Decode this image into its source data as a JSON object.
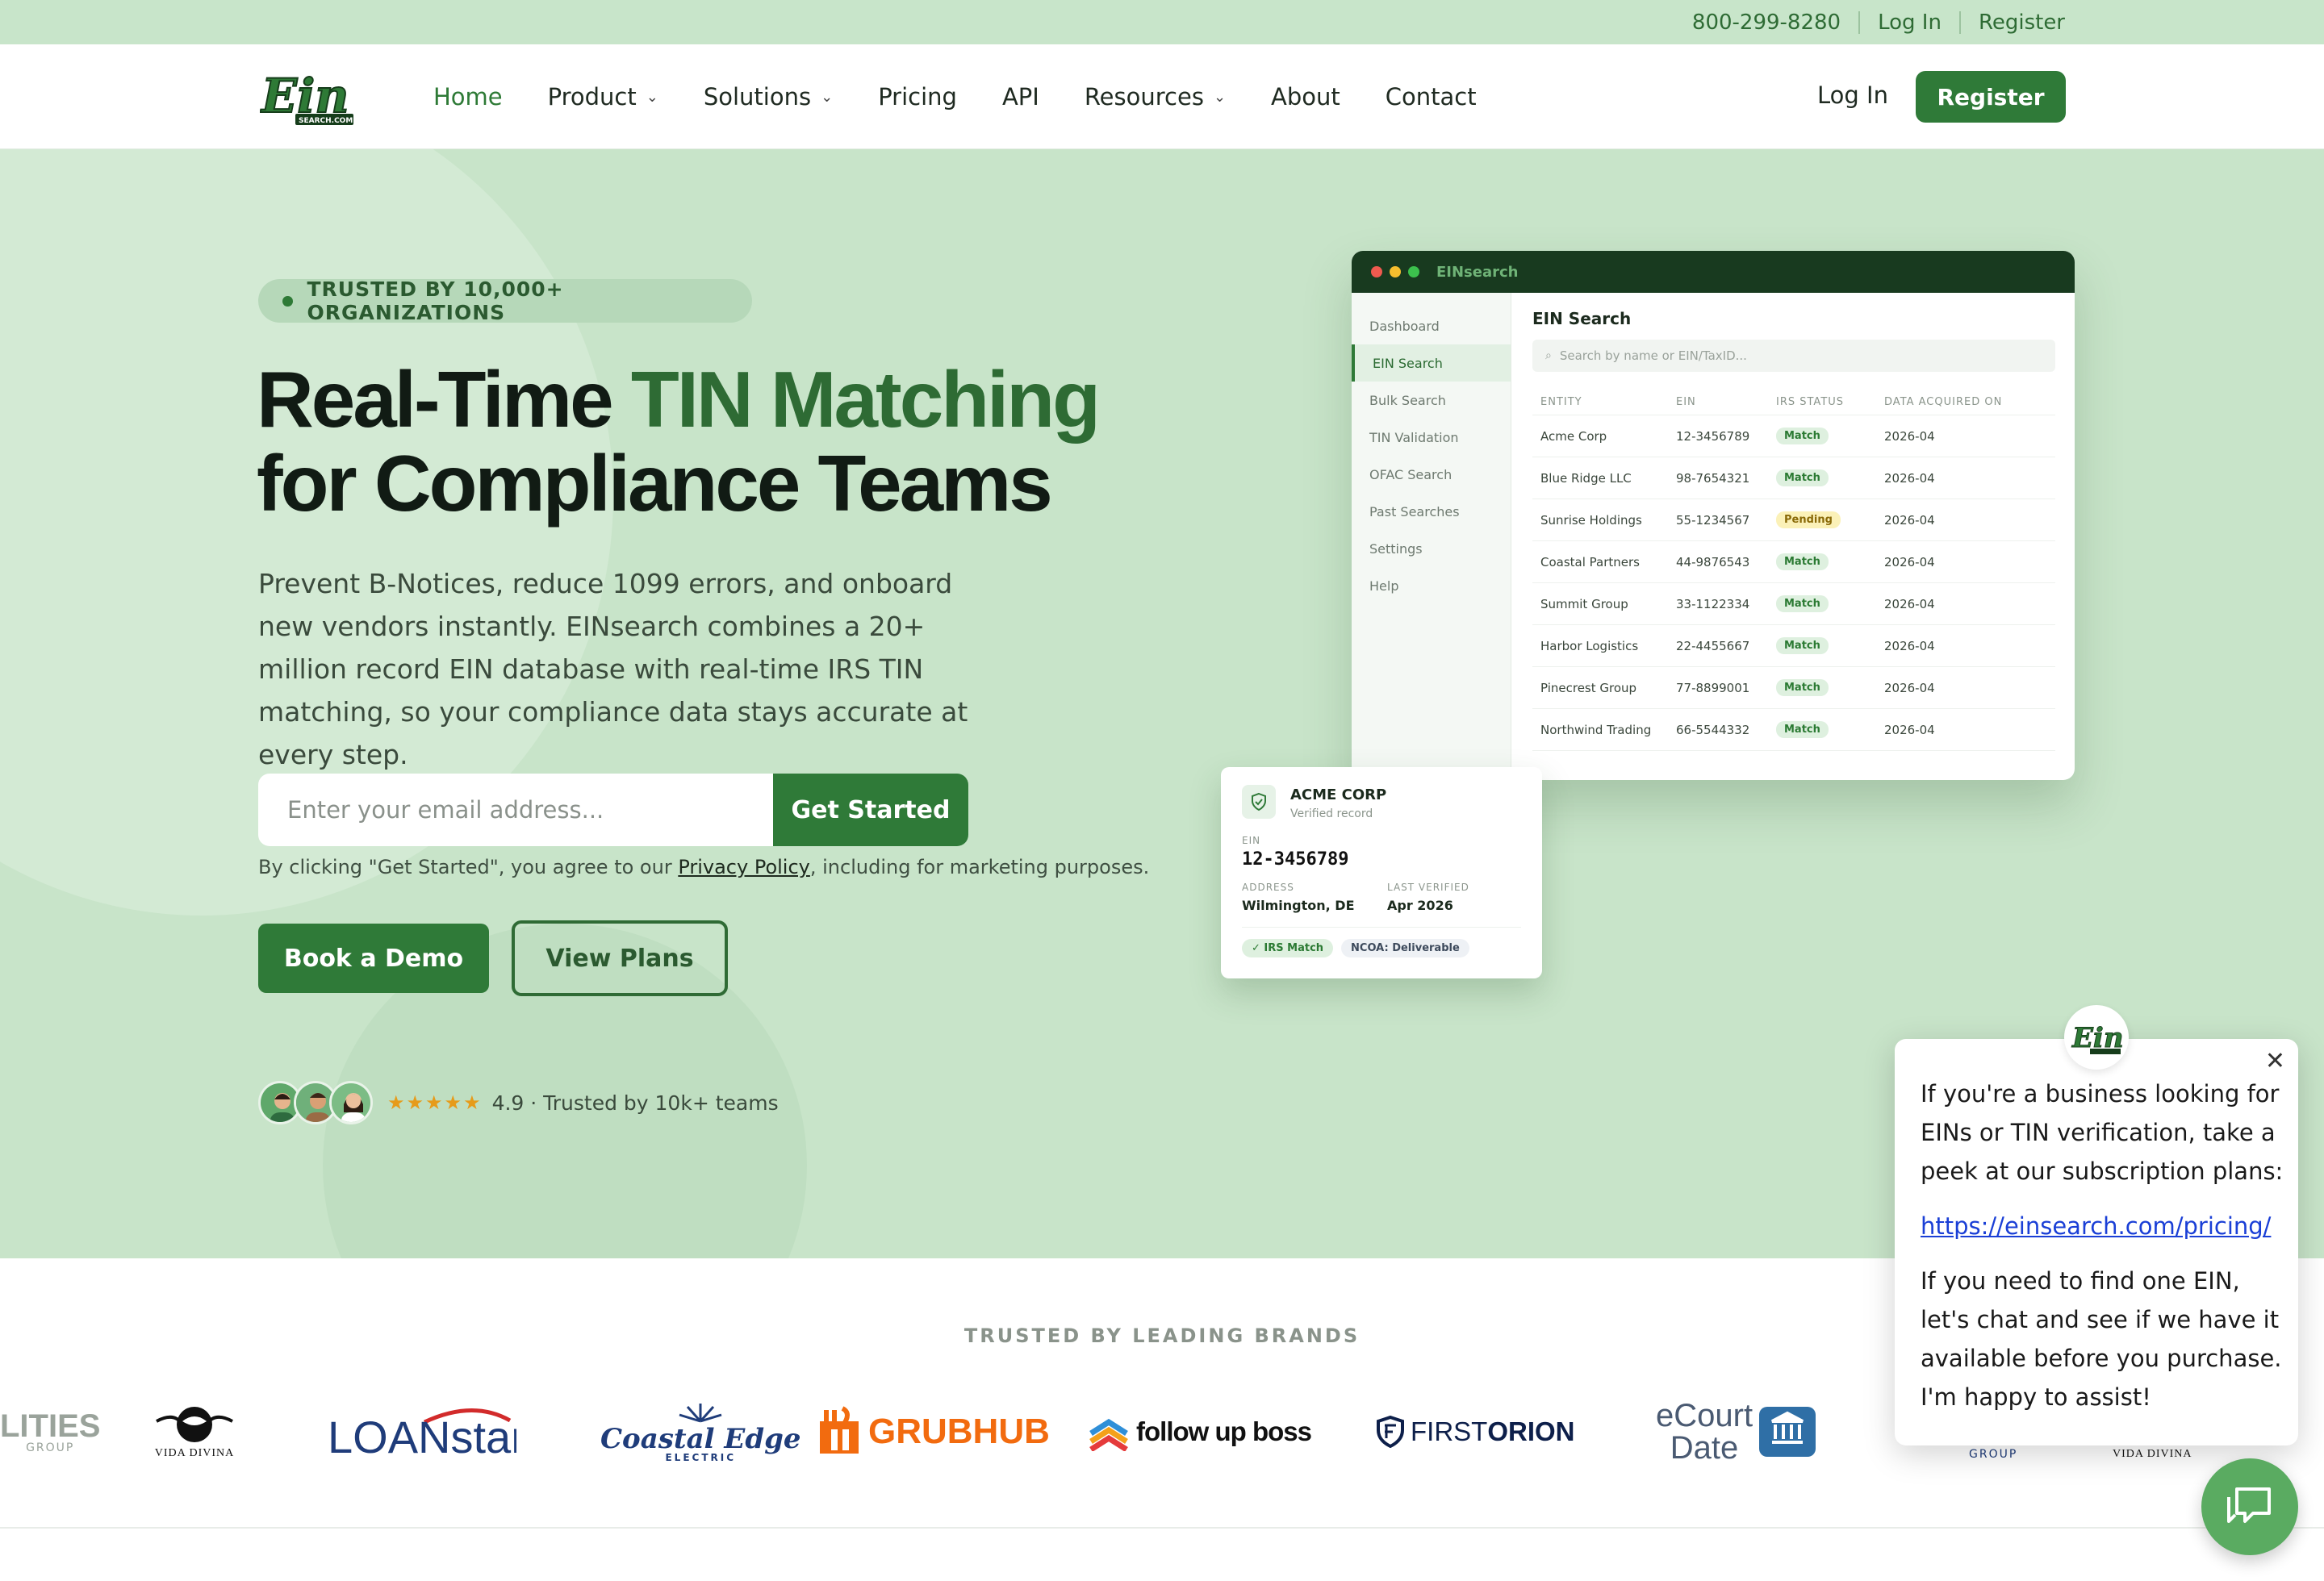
{
  "topbar": {
    "phone": "800-299-8280",
    "login": "Log In",
    "register": "Register"
  },
  "nav": {
    "logo_text": "Ein",
    "logo_sub": "SEARCH.COM",
    "items": [
      {
        "label": "Home"
      },
      {
        "label": "Product"
      },
      {
        "label": "Solutions"
      },
      {
        "label": "Pricing"
      },
      {
        "label": "API"
      },
      {
        "label": "Resources"
      },
      {
        "label": "About"
      },
      {
        "label": "Contact"
      }
    ],
    "login": "Log In",
    "register": "Register"
  },
  "hero": {
    "badge": "TRUSTED BY 10,000+ ORGANIZATIONS",
    "title_a": "Real-Time ",
    "title_b": "TIN Matching",
    "title_c": "for Compliance Teams",
    "lead": "Prevent B-Notices, reduce 1099 errors, and onboard new vendors instantly. EINsearch combines a 20+ million record EIN database with real-time IRS TIN matching, so your compliance data stays accurate at every step.",
    "email_placeholder": "Enter your email address...",
    "cta": "Get Started",
    "consent_a": "By clicking \"Get Started\", you agree to our ",
    "consent_link": "Privacy Policy",
    "consent_b": ", including for marketing purposes.",
    "demo": "Book a Demo",
    "plans": "View Plans",
    "stars": "★★★★★",
    "rating": "4.9 · Trusted by 10k+ teams"
  },
  "app": {
    "brand": "EINsearch",
    "sidebar": [
      "Dashboard",
      "EIN Search",
      "Bulk Search",
      "TIN Validation",
      "OFAC Search",
      "Past Searches",
      "Settings",
      "Help"
    ],
    "title": "EIN Search",
    "search_placeholder": "Search by name or EIN/TaxID...",
    "columns": [
      "ENTITY",
      "EIN",
      "IRS STATUS",
      "DATA ACQUIRED ON"
    ],
    "rows": [
      {
        "entity": "Acme Corp",
        "ein": "12-3456789",
        "status": "Match",
        "date": "2026-04"
      },
      {
        "entity": "Blue Ridge LLC",
        "ein": "98-7654321",
        "status": "Match",
        "date": "2026-04"
      },
      {
        "entity": "Sunrise Holdings",
        "ein": "55-1234567",
        "status": "Pending",
        "date": "2026-04"
      },
      {
        "entity": "Coastal Partners",
        "ein": "44-9876543",
        "status": "Match",
        "date": "2026-04"
      },
      {
        "entity": "Summit Group",
        "ein": "33-1122334",
        "status": "Match",
        "date": "2026-04"
      },
      {
        "entity": "Harbor Logistics",
        "ein": "22-4455667",
        "status": "Match",
        "date": "2026-04"
      },
      {
        "entity": "Pinecrest Group",
        "ein": "77-8899001",
        "status": "Match",
        "date": "2026-04"
      },
      {
        "entity": "Northwind Trading",
        "ein": "66-5544332",
        "status": "Match",
        "date": "2026-04"
      }
    ]
  },
  "card": {
    "name": "ACME CORP",
    "verified": "Verified record",
    "ein_label": "EIN",
    "ein": "12-3456789",
    "address_label": "ADDRESS",
    "address": "Wilmington, DE",
    "last_label": "LAST VERIFIED",
    "last": "Apr 2026",
    "tag1": "✓ IRS Match",
    "tag2": "NCOA: Deliverable"
  },
  "brands": {
    "title": "TRUSTED BY LEADING BRANDS",
    "items": [
      "LITIES",
      "GROUP",
      "VIDA DIVINA",
      "LOANstar",
      "Coastal Edge",
      "ELECTRIC",
      "GRUBHUB",
      "follow up boss",
      "FIRST",
      "ORION",
      "eCourt",
      "Date",
      "GROUP",
      "VIDA DIVINA"
    ]
  },
  "chat": {
    "p1": "If you're a business looking for EINs or TIN verification, take a peek at our subscription plans:",
    "link": "https://einsearch.com/pricing/",
    "p2": "If you need to find one EIN, let's chat and see if we have it available before you purchase. I'm happy to assist!"
  }
}
